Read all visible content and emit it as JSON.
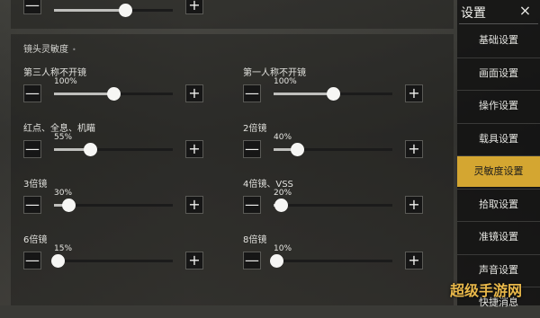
{
  "section_title": "镜头灵敏度",
  "section_dot": "•",
  "top_partial": {
    "percent": "60%",
    "value": 0.6
  },
  "buttons": {
    "minus": "—",
    "plus": "+"
  },
  "settings": [
    {
      "label": "第三人称不开镜",
      "percent": "100%",
      "value": 0.5
    },
    {
      "label": "第一人称不开镜",
      "percent": "100%",
      "value": 0.5
    },
    {
      "label": "红点、全息、机瞄",
      "percent": "55%",
      "value": 0.3
    },
    {
      "label": "2倍镜",
      "percent": "40%",
      "value": 0.2
    },
    {
      "label": "3倍镜",
      "percent": "30%",
      "value": 0.12
    },
    {
      "label": "4倍镜、VSS",
      "percent": "20%",
      "value": 0.06
    },
    {
      "label": "6倍镜",
      "percent": "15%",
      "value": 0.03
    },
    {
      "label": "8倍镜",
      "percent": "10%",
      "value": 0.02
    }
  ],
  "sidebar": {
    "title": "设置",
    "close_icon": "×",
    "items": [
      {
        "label": "基础设置",
        "active": false
      },
      {
        "label": "画面设置",
        "active": false
      },
      {
        "label": "操作设置",
        "active": false
      },
      {
        "label": "载具设置",
        "active": false
      },
      {
        "label": "灵敏度设置",
        "active": true
      },
      {
        "label": "拾取设置",
        "active": false
      },
      {
        "label": "准镜设置",
        "active": false
      },
      {
        "label": "声音设置",
        "active": false
      },
      {
        "label": "快捷消息",
        "active": false
      }
    ]
  },
  "watermark": "超级手游网"
}
